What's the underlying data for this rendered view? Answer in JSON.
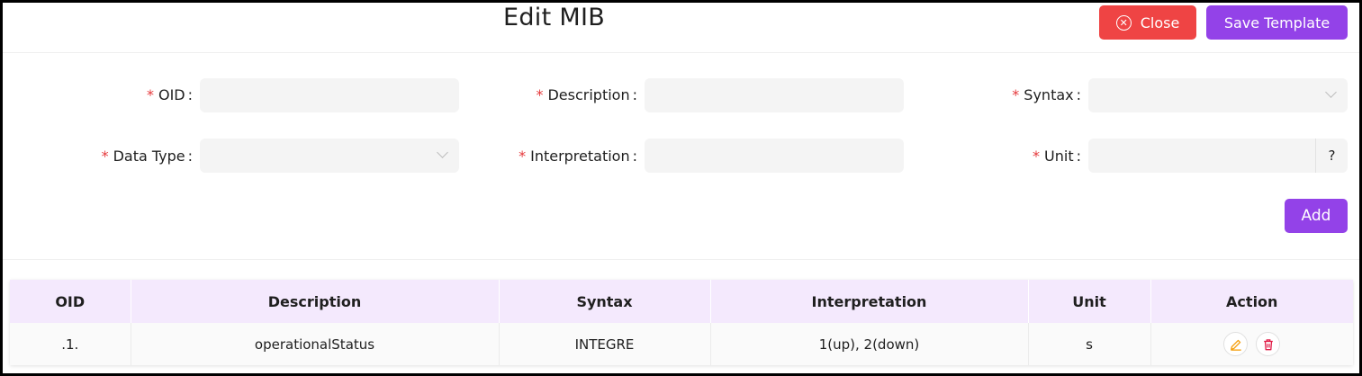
{
  "header": {
    "title": "Edit MIB",
    "close_label": "Close",
    "save_label": "Save Template"
  },
  "form": {
    "required_mark": "*",
    "colon": ":",
    "oid": {
      "label": "OID",
      "value": ""
    },
    "description": {
      "label": "Description",
      "value": ""
    },
    "syntax": {
      "label": "Syntax",
      "value": ""
    },
    "data_type": {
      "label": "Data Type",
      "value": ""
    },
    "interpretation": {
      "label": "Interpretation",
      "value": ""
    },
    "unit": {
      "label": "Unit",
      "value": "",
      "addon": "?"
    },
    "add_label": "Add"
  },
  "table": {
    "columns": [
      "OID",
      "Description",
      "Syntax",
      "Interpretation",
      "Unit",
      "Action"
    ],
    "rows": [
      {
        "oid": ".1.",
        "description": "operationalStatus",
        "syntax": "INTEGRE",
        "interpretation": "1(up), 2(down)",
        "unit": "s",
        "actions": [
          "edit-icon",
          "delete-icon"
        ]
      }
    ]
  },
  "colors": {
    "primary": "#9342e8",
    "danger": "#ef4444",
    "header_bg": "#f4e9fd",
    "edit_icon": "#f59e0b",
    "delete_icon": "#e11d48"
  }
}
